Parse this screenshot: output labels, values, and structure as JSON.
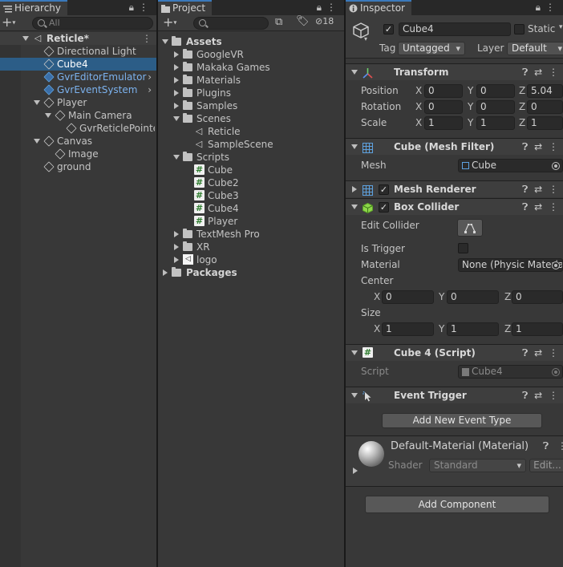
{
  "hierarchy": {
    "tab_label": "Hierarchy",
    "search_placeholder": "All",
    "scene": "Reticle*",
    "items": [
      {
        "label": "Directional Light"
      },
      {
        "label": "Cube4"
      },
      {
        "label": "GvrEditorEmulator"
      },
      {
        "label": "GvrEventSystem"
      },
      {
        "label": "Player"
      },
      {
        "label": "Main Camera"
      },
      {
        "label": "GvrReticlePointer"
      },
      {
        "label": "Canvas"
      },
      {
        "label": "Image"
      },
      {
        "label": "ground"
      }
    ]
  },
  "project": {
    "tab_label": "Project",
    "hidden_count": "18",
    "items": [
      {
        "label": "Assets"
      },
      {
        "label": "GoogleVR"
      },
      {
        "label": "Makaka Games"
      },
      {
        "label": "Materials"
      },
      {
        "label": "Plugins"
      },
      {
        "label": "Samples"
      },
      {
        "label": "Scenes"
      },
      {
        "label": "Reticle"
      },
      {
        "label": "SampleScene"
      },
      {
        "label": "Scripts"
      },
      {
        "label": "Cube"
      },
      {
        "label": "Cube2"
      },
      {
        "label": "Cube3"
      },
      {
        "label": "Cube4"
      },
      {
        "label": "Player"
      },
      {
        "label": "TextMesh Pro"
      },
      {
        "label": "XR"
      },
      {
        "label": "logo"
      },
      {
        "label": "Packages"
      }
    ]
  },
  "inspector": {
    "tab_label": "Inspector",
    "object_name": "Cube4",
    "static_label": "Static",
    "tag_label": "Tag",
    "tag_value": "Untagged",
    "layer_label": "Layer",
    "layer_value": "Default",
    "transform": {
      "title": "Transform",
      "position_label": "Position",
      "rotation_label": "Rotation",
      "scale_label": "Scale",
      "position": {
        "x": "0",
        "y": "0",
        "z": "5.04"
      },
      "rotation": {
        "x": "0",
        "y": "0",
        "z": "0"
      },
      "scale": {
        "x": "1",
        "y": "1",
        "z": "1"
      }
    },
    "mesh_filter": {
      "title": "Cube (Mesh Filter)",
      "mesh_label": "Mesh",
      "mesh_value": "Cube"
    },
    "mesh_renderer": {
      "title": "Mesh Renderer"
    },
    "box_collider": {
      "title": "Box Collider",
      "edit_label": "Edit Collider",
      "trigger_label": "Is Trigger",
      "material_label": "Material",
      "material_value": "None (Physic Material)",
      "center_label": "Center",
      "size_label": "Size",
      "center": {
        "x": "0",
        "y": "0",
        "z": "0"
      },
      "size": {
        "x": "1",
        "y": "1",
        "z": "1"
      }
    },
    "script": {
      "title": "Cube 4 (Script)",
      "script_label": "Script",
      "script_value": "Cube4"
    },
    "event_trigger": {
      "title": "Event Trigger",
      "add_button": "Add New Event Type"
    },
    "material": {
      "name": "Default-Material (Material)",
      "shader_label": "Shader",
      "shader_value": "Standard",
      "edit_label": "Edit..."
    },
    "add_component": "Add Component"
  },
  "axes": {
    "x": "X",
    "y": "Y",
    "z": "Z"
  },
  "colors": {
    "selection": "#2c5d87",
    "accent": "#3a79bb",
    "prefab_text": "#7cb2ee"
  }
}
